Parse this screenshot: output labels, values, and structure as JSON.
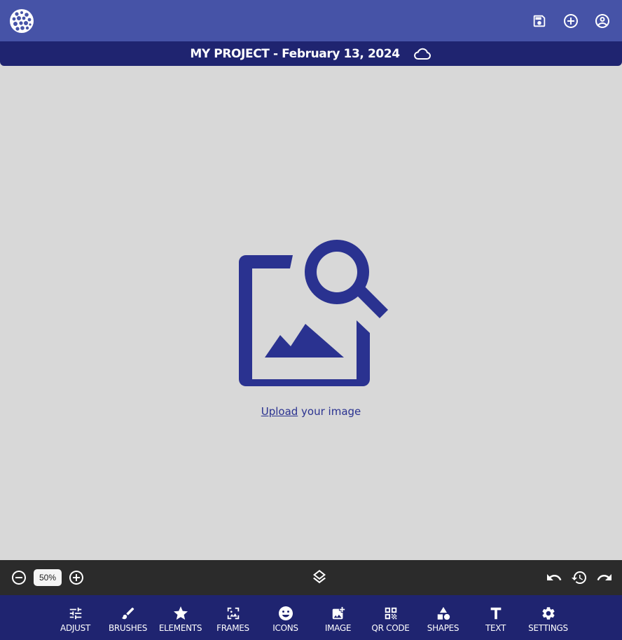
{
  "header": {
    "logo_icon": "bubbles-logo-icon",
    "actions": [
      {
        "name": "save-icon"
      },
      {
        "name": "add-circle-icon"
      },
      {
        "name": "account-icon"
      }
    ]
  },
  "project": {
    "title": "MY PROJECT - February 13, 2024",
    "sync_icon": "cloud-icon"
  },
  "canvas": {
    "placeholder_icon": "image-search-icon",
    "upload_link": "Upload",
    "upload_rest": " your image"
  },
  "zoom": {
    "value": "50%"
  },
  "tools": [
    {
      "label": "ADJUST",
      "icon": "sliders-icon"
    },
    {
      "label": "BRUSHES",
      "icon": "brush-icon"
    },
    {
      "label": "ELEMENTS",
      "icon": "star-icon"
    },
    {
      "label": "FRAMES",
      "icon": "frame-icon"
    },
    {
      "label": "ICONS",
      "icon": "emoji-icon"
    },
    {
      "label": "IMAGE",
      "icon": "add-image-icon"
    },
    {
      "label": "QR CODE",
      "icon": "qr-code-icon"
    },
    {
      "label": "SHAPES",
      "icon": "shapes-icon"
    },
    {
      "label": "TEXT",
      "icon": "text-icon"
    },
    {
      "label": "SETTINGS",
      "icon": "gear-icon"
    }
  ],
  "colors": {
    "topbar": "#4653a7",
    "titlebar": "#1f2470",
    "accent": "#2a3290",
    "canvas": "#d8d8d8",
    "zoombar": "#2b2b2b"
  }
}
